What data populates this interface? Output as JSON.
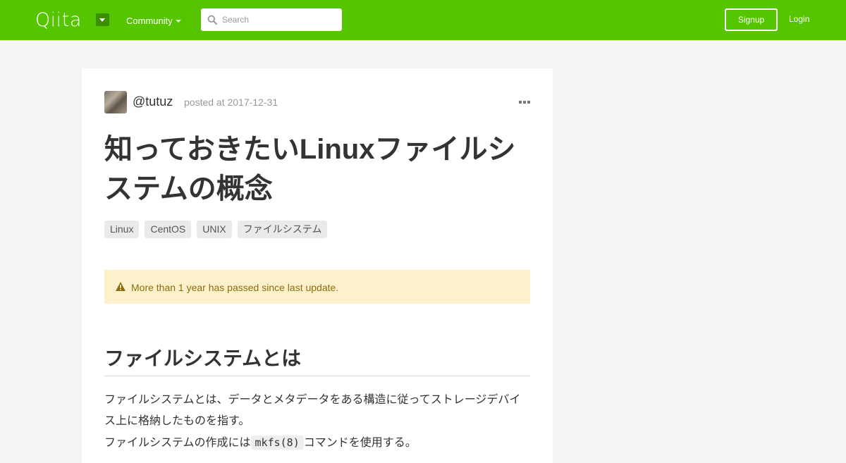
{
  "header": {
    "logo": "Qiita",
    "community_label": "Community",
    "search_placeholder": "Search",
    "signup_label": "Signup",
    "login_label": "Login"
  },
  "article": {
    "author": "@tutuz",
    "posted": "posted at 2017-12-31",
    "title": "知っておきたいLinuxファイルシステムの概念",
    "tags": [
      "Linux",
      "CentOS",
      "UNIX",
      "ファイルシステム"
    ],
    "alert": "More than 1 year has passed since last update.",
    "section_heading": "ファイルシステムとは",
    "paragraph1": "ファイルシステムとは、データとメタデータをある構造に従ってストレージデバイス上に格納したものを指す。",
    "paragraph2_prefix": "ファイルシステムの作成には",
    "paragraph2_code": "mkfs(8)",
    "paragraph2_suffix": "コマンドを使用する。"
  },
  "colors": {
    "brand_green": "#55c500",
    "alert_bg": "#fdf1cb",
    "alert_text": "#8a6d10"
  }
}
